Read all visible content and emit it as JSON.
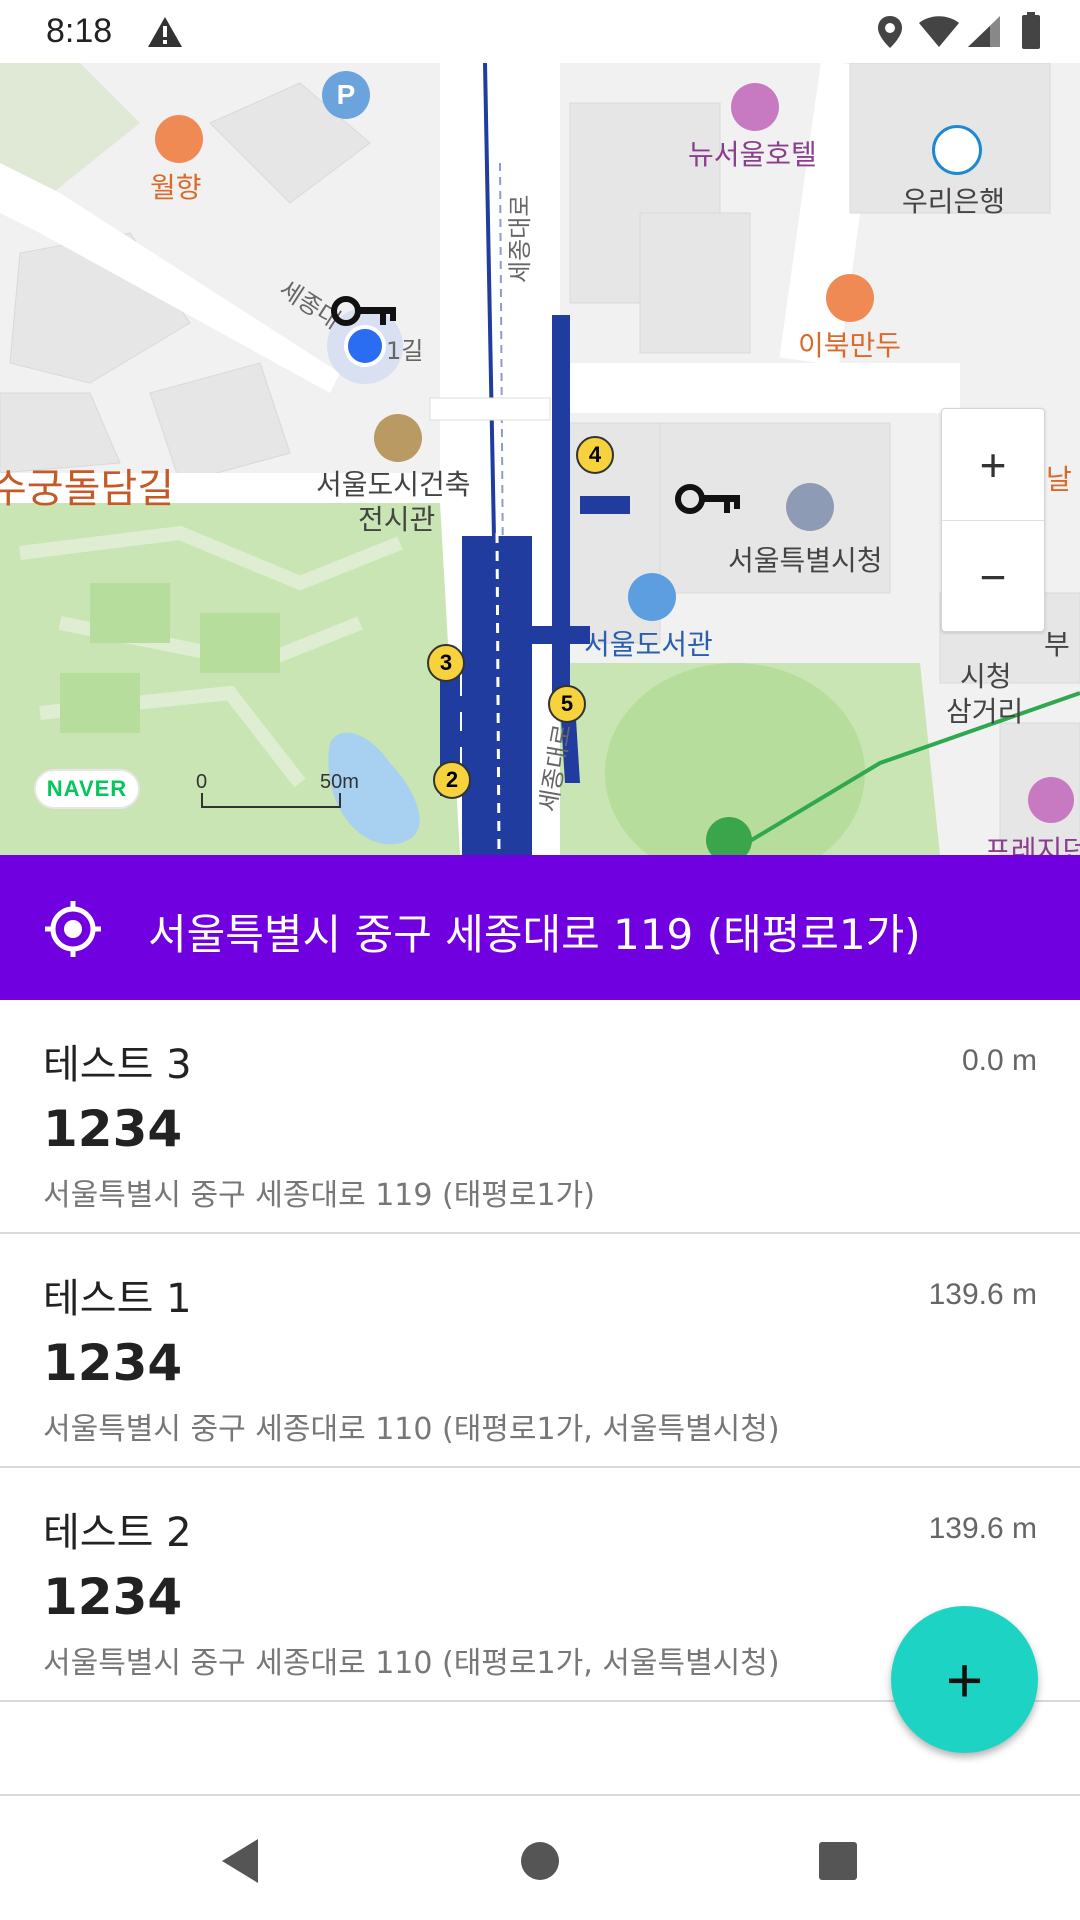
{
  "status_bar": {
    "time": "8:18"
  },
  "map": {
    "labels": {
      "parking": "P",
      "wolhyang": "월향",
      "new_seoul_hotel": "뉴서울호텔",
      "woori_bank": "우리은행",
      "ibuk_mandu": "이북만두",
      "sejong_road_vertical": "세종대로",
      "sejong_road_1gil_a": "세종대",
      "sejong_road_1gil_b": "1길",
      "deoksugung": "수궁돌담길",
      "architecture_museum_1": "서울도시건축",
      "architecture_museum_2": "전시관",
      "city_hall": "서울특별시청",
      "library": "서울도서관",
      "city_hall_intersection_1": "시청",
      "city_hall_intersection_2": "삼거리",
      "sejong_road_lower": "세종대로",
      "partial_nal": "날",
      "partial_bu": "부",
      "partial_press": "프레지던",
      "exit_4": "4",
      "exit_3": "3",
      "exit_5": "5",
      "exit_2": "2"
    },
    "zoom_in": "+",
    "zoom_out": "−",
    "logo": "NAVER",
    "scale_start": "0",
    "scale_end": "50m"
  },
  "address_bar": {
    "address": "서울특별시 중구 세종대로 119 (태평로1가)"
  },
  "items": [
    {
      "title": "테스트 3",
      "distance": "0.0 m",
      "code": "1234",
      "address": "서울특별시 중구 세종대로 119 (태평로1가)"
    },
    {
      "title": "테스트 1",
      "distance": "139.6 m",
      "code": "1234",
      "address": "서울특별시 중구 세종대로 110 (태평로1가, 서울특별시청)"
    },
    {
      "title": "테스트 2",
      "distance": "139.6 m",
      "code": "1234",
      "address": "서울특별시 중구 세종대로 110 (태평로1가, 서울특별시청)"
    }
  ],
  "fab": {
    "label": "+"
  },
  "colors": {
    "accent": "#7000e0",
    "fab": "#1dd4c4",
    "subway": "#1f3c9e",
    "park": "#c9e5b3"
  }
}
